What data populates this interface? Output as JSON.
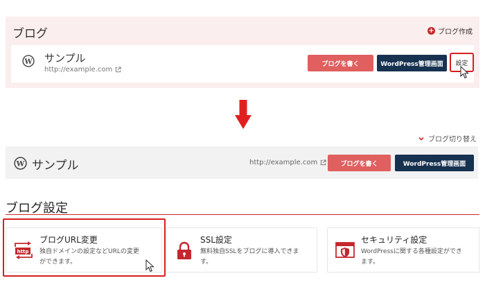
{
  "top": {
    "title": "ブログ",
    "create_label": "ブログ作成",
    "blog_name": "サンプル",
    "blog_url": "http://example.com",
    "write_button": "ブログを書く",
    "admin_button": "WordPress管理画面",
    "settings_button": "設定"
  },
  "switch_label": "ブログ切り替え",
  "middle": {
    "blog_name": "サンプル",
    "blog_url": "http://example.com",
    "write_button": "ブログを書く",
    "admin_button": "WordPress管理画面"
  },
  "settings": {
    "title": "ブログ設定",
    "cards": [
      {
        "title": "ブログURL変更",
        "desc": "独自ドメインの設定などURLの変更\nができます。",
        "icon": "http-icon",
        "icon_text": "http"
      },
      {
        "title": "SSL設定",
        "desc": "無料独自SSLをブログに導入できま\nす。",
        "icon": "lock-icon"
      },
      {
        "title": "セキュリティ設定",
        "desc": "WordPressに関する各種設定ができ\nます。",
        "icon": "shield-browser-icon"
      }
    ]
  },
  "colors": {
    "accent_red": "#c4272c",
    "button_red": "#e05f5f",
    "button_navy": "#173150",
    "highlight": "#d71e1e",
    "panel_pink": "#fbeeee"
  }
}
